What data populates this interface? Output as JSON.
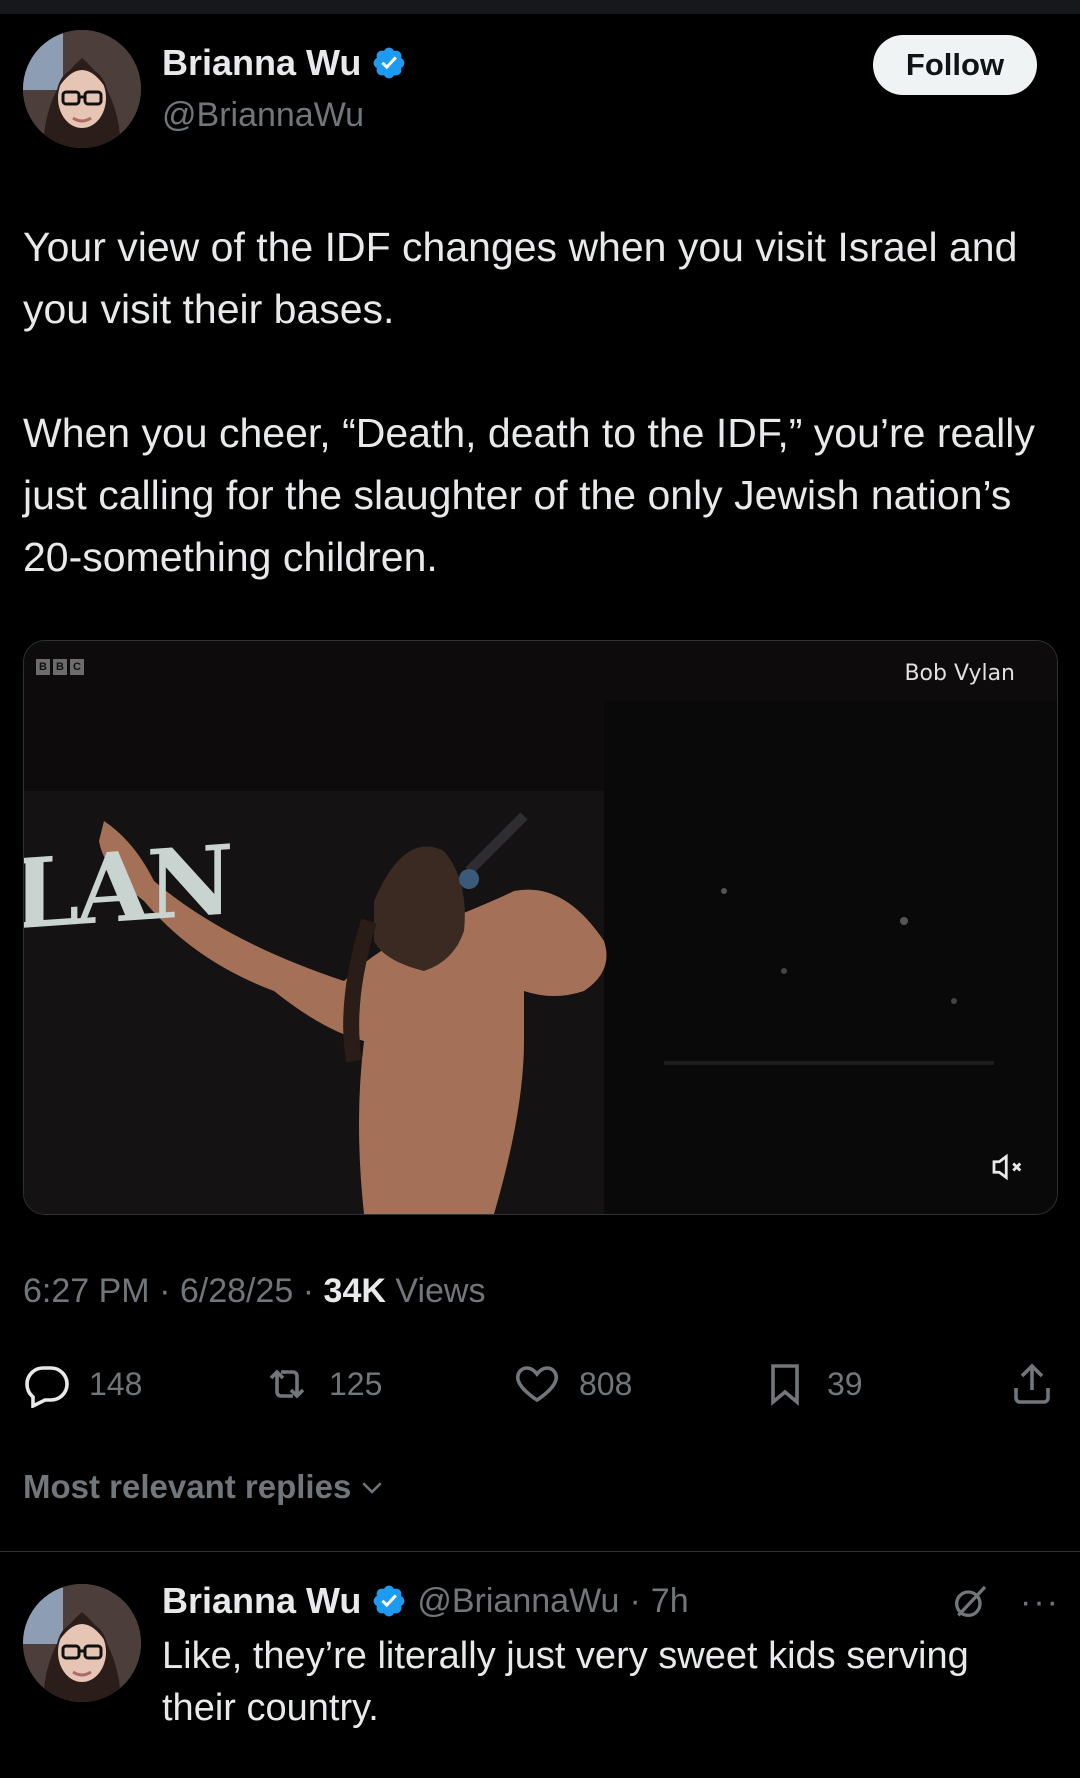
{
  "tweet": {
    "author_name": "Brianna Wu",
    "author_handle": "@BriannaWu",
    "follow_label": "Follow",
    "paragraphs": [
      "Your view of the IDF changes when you visit Israel and you visit their bases.",
      "When you cheer, “Death, death to the IDF,” you’re really just calling for the slaughter of the only Jewish nation’s 20-something children."
    ],
    "media": {
      "channel_logo": [
        "B",
        "B",
        "C"
      ],
      "label": "Bob Vylan",
      "backdrop_text": "LAN"
    },
    "time": "6:27 PM",
    "date": "6/28/25",
    "views_count": "34K",
    "views_label": "Views",
    "replies": "148",
    "reposts": "125",
    "likes": "808",
    "bookmarks": "39"
  },
  "replies_filter": "Most relevant replies",
  "reply": {
    "author_name": "Brianna Wu",
    "author_handle": "@BriannaWu",
    "time_ago": "7h",
    "text": "Like, they’re literally just very sweet kids serving their country."
  },
  "colors": {
    "background": "#000000",
    "text": "#e7e9ea",
    "secondary": "#71767b",
    "verified": "#1d9bf0"
  }
}
